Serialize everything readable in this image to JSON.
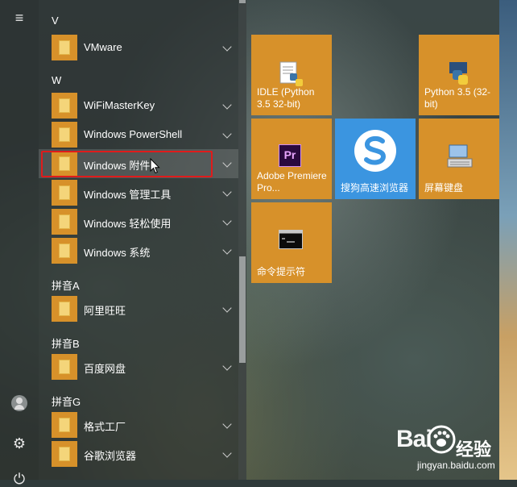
{
  "app_list": {
    "groups": [
      {
        "header": "V",
        "apps": [
          {
            "label": "VMware"
          }
        ]
      },
      {
        "header": "W",
        "apps": [
          {
            "label": "WiFiMasterKey"
          },
          {
            "label": "Windows PowerShell"
          },
          {
            "label": "Windows 附件"
          },
          {
            "label": "Windows 管理工具"
          },
          {
            "label": "Windows 轻松使用"
          },
          {
            "label": "Windows 系统"
          }
        ]
      },
      {
        "header": "拼音A",
        "apps": [
          {
            "label": "阿里旺旺"
          }
        ]
      },
      {
        "header": "拼音B",
        "apps": [
          {
            "label": "百度网盘"
          }
        ]
      },
      {
        "header": "拼音G",
        "apps": [
          {
            "label": "格式工厂"
          },
          {
            "label": "谷歌浏览器"
          }
        ]
      }
    ]
  },
  "tiles": [
    {
      "label": "IDLE (Python 3.5 32-bit)",
      "icon": "idle-python-icon"
    },
    {
      "label": "Python 3.5 (32-bit)",
      "icon": "python-icon"
    },
    {
      "label": "Adobe Premiere Pro...",
      "icon": "premiere-pro-icon"
    },
    {
      "label": "搜狗高速浏览器",
      "icon": "sogou-browser-icon"
    },
    {
      "label": "屏幕键盘",
      "icon": "on-screen-keyboard-icon"
    },
    {
      "label": "命令提示符",
      "icon": "command-prompt-icon"
    }
  ],
  "watermark": {
    "logo_text": "Bai",
    "cn_text": "经验",
    "url": "jingyan.baidu.com"
  },
  "colors": {
    "tile_accent": "#d7912a",
    "sogou_tile": "#3b95e0",
    "highlight_border": "#e01b1b"
  }
}
